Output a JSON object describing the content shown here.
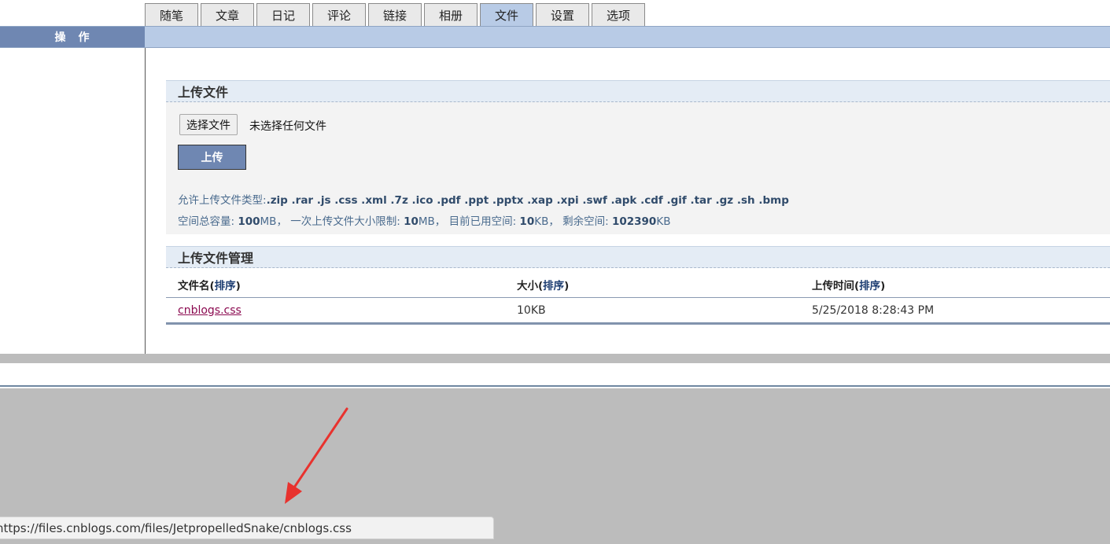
{
  "tabs": [
    {
      "label": "随笔",
      "active": false
    },
    {
      "label": "文章",
      "active": false
    },
    {
      "label": "日记",
      "active": false
    },
    {
      "label": "评论",
      "active": false
    },
    {
      "label": "链接",
      "active": false
    },
    {
      "label": "相册",
      "active": false
    },
    {
      "label": "文件",
      "active": true
    },
    {
      "label": "设置",
      "active": false
    },
    {
      "label": "选项",
      "active": false
    }
  ],
  "sidebar": {
    "header": "操　作"
  },
  "upload": {
    "title": "上传文件",
    "choose_label": "选择文件",
    "no_file_text": "未选择任何文件",
    "upload_label": "上传",
    "types_label": "允许上传文件类型:",
    "types_value": ".zip .rar .js .css .xml .7z .ico .pdf .ppt .pptx .xap .xpi .swf .apk .cdf .gif .tar .gz .sh .bmp",
    "space": {
      "total_label": "空间总容量: ",
      "total_value": "100",
      "total_unit": "MB， ",
      "limit_label": "一次上传文件大小限制: ",
      "limit_value": "10",
      "limit_unit": "MB， ",
      "used_label": "目前已用空间: ",
      "used_value": "10",
      "used_unit": "KB， ",
      "free_label": "剩余空间: ",
      "free_value": "102390",
      "free_unit": "KB"
    }
  },
  "manage": {
    "title": "上传文件管理",
    "columns": [
      {
        "label": "文件名",
        "sort": "排序"
      },
      {
        "label": "大小",
        "sort": "排序"
      },
      {
        "label": "上传时间",
        "sort": "排序"
      }
    ],
    "rows": [
      {
        "name": "cnblogs.css",
        "size": "10KB",
        "time": "5/25/2018 8:28:43 PM"
      }
    ]
  },
  "status_bar": {
    "url": "https://files.cnblogs.com/files/JetpropelledSnake/cnblogs.css"
  },
  "icons": {
    "annotation": "red-arrow-icon"
  },
  "colors": {
    "tab_active": "#b8cbe6",
    "header_bar": "#b8cbe6",
    "button": "#6f87b2",
    "link": "#8b0a50",
    "arrow": "#e8322e"
  }
}
